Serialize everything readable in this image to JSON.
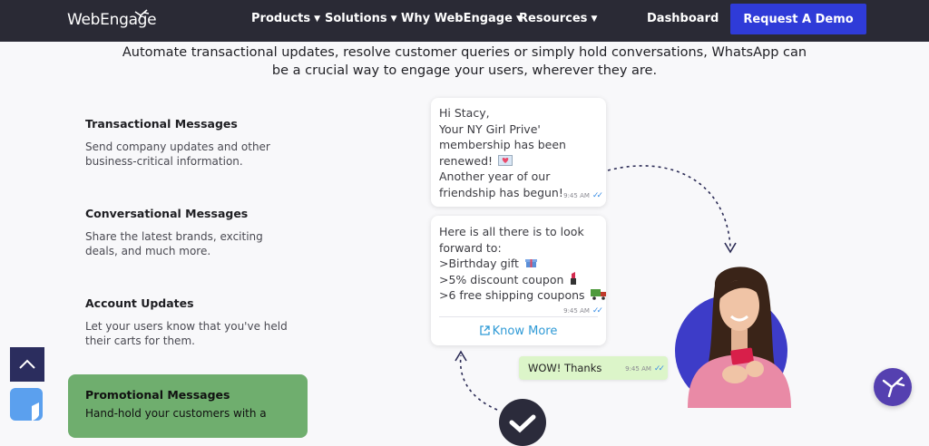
{
  "nav": {
    "logo": "WebEngage",
    "menu": [
      "Products",
      "Solutions",
      "Why WebEngage",
      "Resources"
    ],
    "dashboard": "Dashboard",
    "demo": "Request A Demo"
  },
  "intro": {
    "line1": "Automate transactional updates, resolve customer queries or simply hold conversations, WhatsApp can",
    "line2": "be a crucial way to engage your users, wherever they are."
  },
  "features": [
    {
      "title": "Transactional Messages",
      "desc1": "Send company updates and other",
      "desc2": "business-critical information."
    },
    {
      "title": "Conversational Messages",
      "desc1": "Share the latest brands, exciting",
      "desc2": "deals, and much more."
    },
    {
      "title": "Account Updates",
      "desc1": "Let your users know that you've held",
      "desc2": "their carts for them."
    },
    {
      "title": "Promotional Messages",
      "desc1": "Hand-hold your customers with a"
    }
  ],
  "chat": {
    "bubble1": [
      "Hi Stacy,",
      "Your NY Girl Prive'",
      "membership has been",
      "renewed!",
      "Another year of our",
      "friendship has begun!"
    ],
    "bubble1_time": "9:45 AM",
    "bubble2": [
      ">Birthday gift",
      ">5% discount coupon",
      ">6 free shipping coupons"
    ],
    "bubble2_intro": [
      "Here is all there is to look",
      "forward to:"
    ],
    "bubble2_time": "9:45 AM",
    "know_more": "Know More",
    "reply": "WOW! Thanks",
    "reply_time": "9:45 AM"
  },
  "colors": {
    "nav_bg": "#2a2a35",
    "accent": "#2f3bd8",
    "promo_bg": "#6fae6e",
    "reply_bg": "#dcf5c9",
    "circle": "#3d3cc8"
  },
  "icons": [
    "chevron-down-icon",
    "external-link-icon",
    "double-tick-icon",
    "heart-envelope-icon",
    "gift-icon",
    "lipstick-icon",
    "truck-icon",
    "check-icon",
    "chevron-up-icon",
    "shield-icon",
    "bird-icon"
  ]
}
